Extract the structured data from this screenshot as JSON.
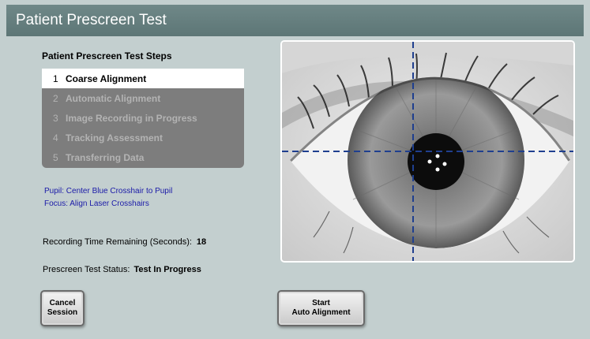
{
  "title": "Patient Prescreen Test",
  "steps": {
    "heading": "Patient Prescreen Test Steps",
    "items": [
      {
        "num": "1",
        "label": "Coarse Alignment",
        "active": true
      },
      {
        "num": "2",
        "label": "Automatic Alignment",
        "active": false
      },
      {
        "num": "3",
        "label": "Image Recording in Progress",
        "active": false
      },
      {
        "num": "4",
        "label": "Tracking Assessment",
        "active": false
      },
      {
        "num": "5",
        "label": "Transferring Data",
        "active": false
      }
    ]
  },
  "instructions": {
    "pupil": "Pupil: Center Blue Crosshair to Pupil",
    "focus": "Focus: Align Laser Crosshairs"
  },
  "recording": {
    "label": "Recording Time Remaining (Seconds):",
    "value": "18"
  },
  "status": {
    "label": "Prescreen Test Status:",
    "value": "Test In Progress"
  },
  "buttons": {
    "cancel": "Cancel\nSession",
    "start": "Start\nAuto Alignment"
  },
  "colors": {
    "title_bar": "#66807f",
    "background": "#c3cfcf",
    "crosshair": "#1f3f8f",
    "instruction_text": "#1a1aa8"
  }
}
